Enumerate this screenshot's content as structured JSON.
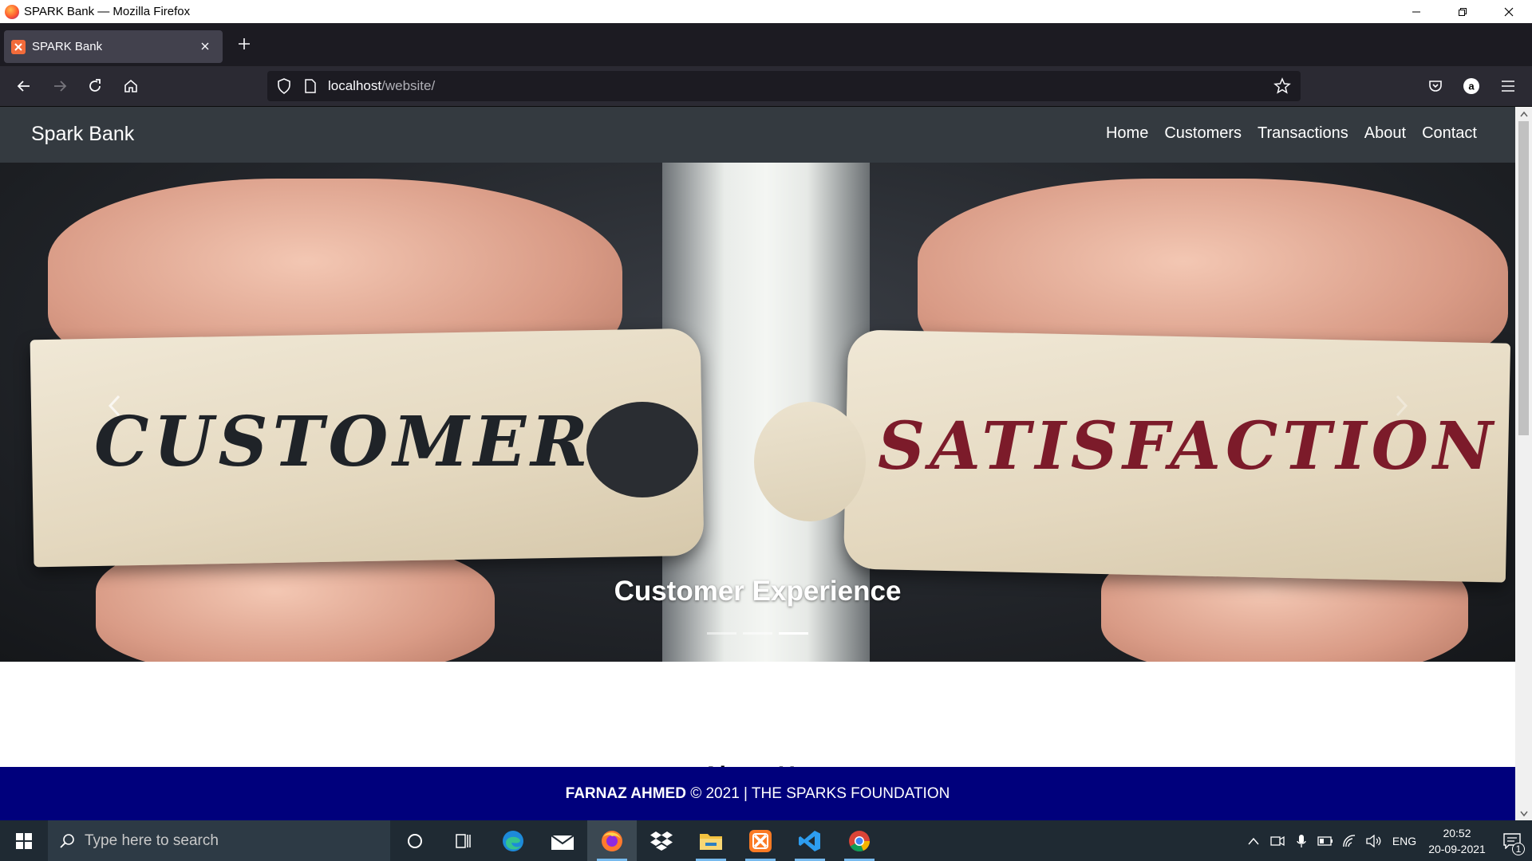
{
  "window": {
    "title": "SPARK Bank — Mozilla Firefox"
  },
  "tab": {
    "title": "SPARK Bank"
  },
  "urlbar": {
    "host": "localhost",
    "path": "/website/"
  },
  "site": {
    "brand": "Spark Bank",
    "nav": [
      "Home",
      "Customers",
      "Transactions",
      "About",
      "Contact"
    ],
    "hero": {
      "word_left": "CUSTOMER",
      "word_right": "SATISFACTION",
      "caption": "Customer Experience",
      "slide_count": 3,
      "active_slide": 3
    },
    "section_heading_partial": "About Us",
    "footer": {
      "name": "FARNAZ AHMED",
      "rest": " © 2021 | THE SPARKS FOUNDATION"
    }
  },
  "taskbar": {
    "search_placeholder": "Type here to search",
    "language": "ENG",
    "time": "20:52",
    "date": "20-09-2021",
    "notification_count": "1"
  },
  "colors": {
    "navbar": "#343a40",
    "footer": "#00007c",
    "accent": "#76b9ed"
  }
}
